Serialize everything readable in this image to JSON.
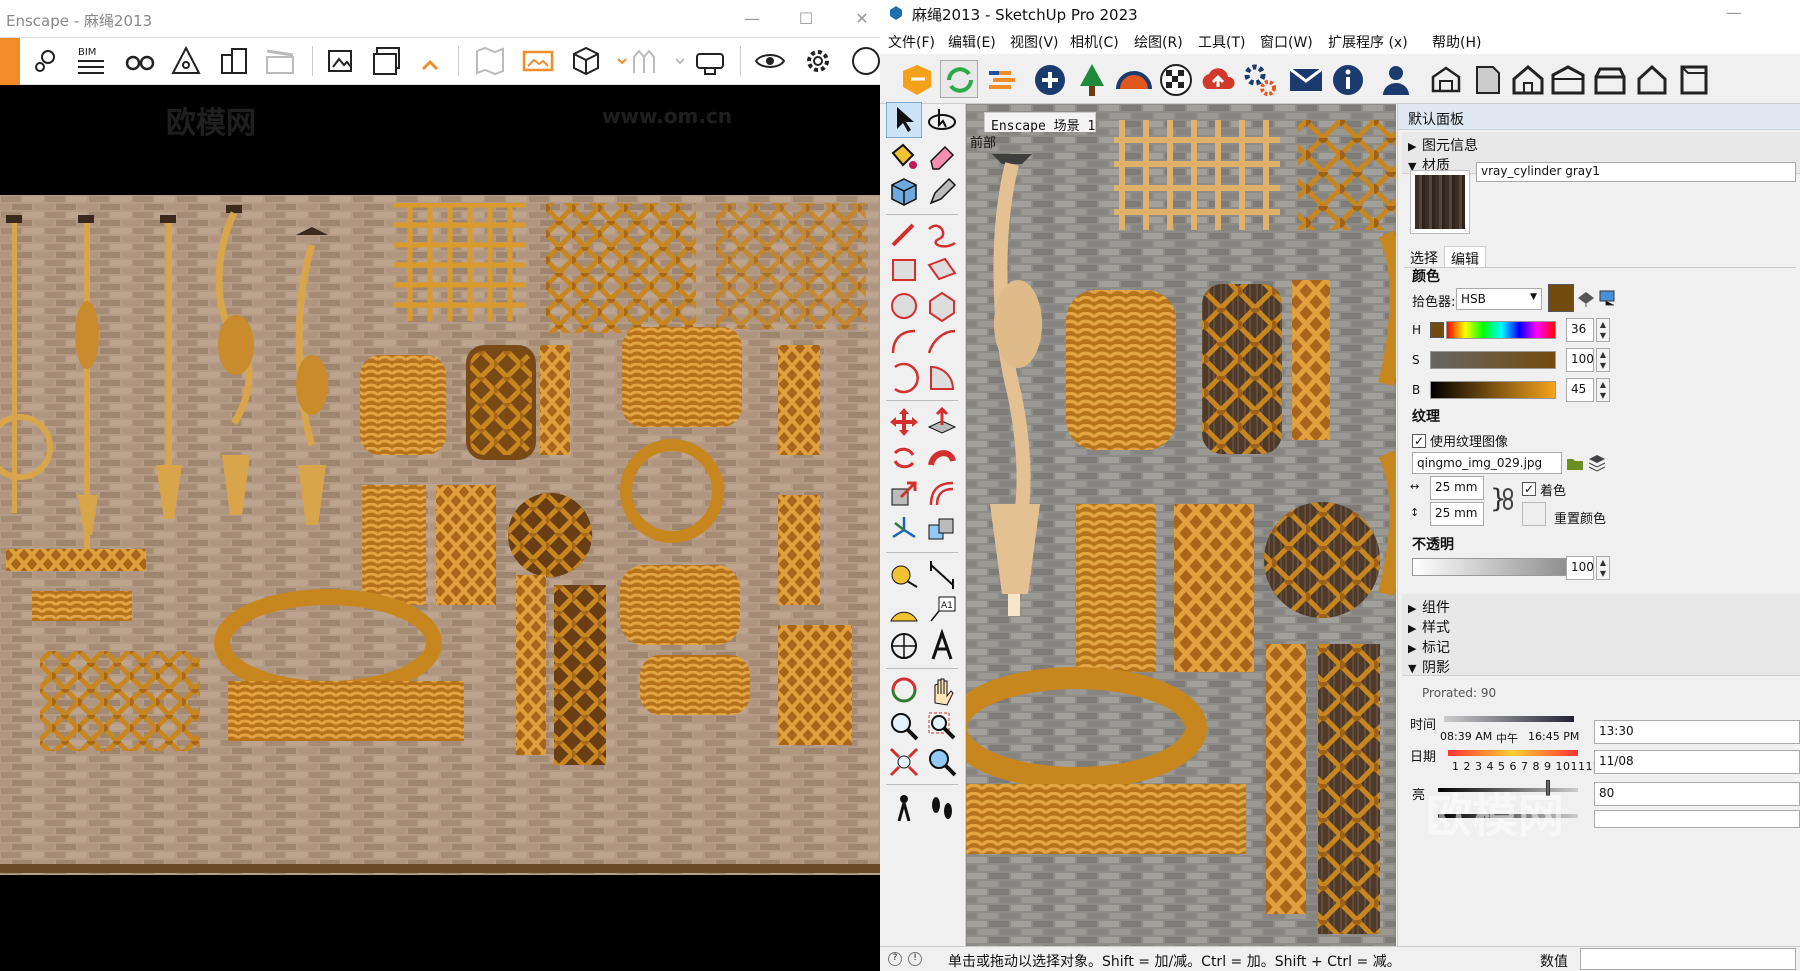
{
  "enscape": {
    "title": "Enscape - 麻绳2013",
    "window_min": "—",
    "window_max": "☐",
    "window_close": "✕",
    "watermarks": [
      "欧模网",
      "www.om.cn"
    ],
    "toolbar_icons": [
      "logo-tab-icon",
      "map-pin-icon",
      "bim-icon",
      "binoculars-icon",
      "warning-icon",
      "buildings-icon",
      "clapper-icon",
      "export-image-icon",
      "batch-export-icon",
      "map-icon",
      "panorama-icon",
      "cube-icon",
      "people-icon",
      "vr-headset-icon",
      "eye-icon",
      "gear-icon",
      "help-icon"
    ],
    "bim_label": "BIM",
    "accent": "#f28c28"
  },
  "sketchup": {
    "title": "麻绳2013 - SketchUp Pro 2023",
    "menus": [
      "文件(F)",
      "编辑(E)",
      "视图(V)",
      "相机(C)",
      "绘图(R)",
      "工具(T)",
      "窗口(W)",
      "扩展程序 (x)",
      "帮助(H)"
    ],
    "scene_tab": "Enscape  场景 1",
    "view_name": "前部",
    "status_message": "单击或拖动以选择对象。Shift = 加/减。Ctrl = 加。Shift + Ctrl = 减。",
    "status_value_label": "数值",
    "watermark": "欧模网"
  },
  "tray": {
    "title": "默认面板",
    "sections": {
      "entity_info": "图元信息",
      "materials": "材质",
      "components": "组件",
      "styles": "样式",
      "tags": "标记",
      "shadows": "阴影"
    },
    "material": {
      "name": "vray_cylinder gray1",
      "tab_select": "选择",
      "tab_edit": "编辑",
      "color_heading": "颜色",
      "picker_label": "拾色器:",
      "picker_value": "HSB",
      "h_label": "H",
      "h_value": "36",
      "s_label": "S",
      "s_value": "100",
      "b_label": "B",
      "b_value": "45",
      "swatch_color": "#734b0e",
      "texture_heading": "纹理",
      "use_texture_label": "使用纹理图像",
      "texture_file": "qingmo_img_029.jpg",
      "width": "25 mm",
      "height": "25 mm",
      "colorize_label": "着色",
      "reset_color_label": "重置颜色",
      "opacity_heading": "不透明",
      "opacity_value": "100"
    },
    "shadows": {
      "time_label": "时间",
      "time_start": "08:39 AM",
      "noon": "中午",
      "time_end": "16:45 PM",
      "time_value": "13:30",
      "date_label": "日期",
      "months": "1 2 3 4 5 6 7 8 9 101112",
      "date_value": "11/08",
      "light_label": "亮",
      "light_value": "80",
      "partial_row": "Prorated: 90"
    }
  }
}
